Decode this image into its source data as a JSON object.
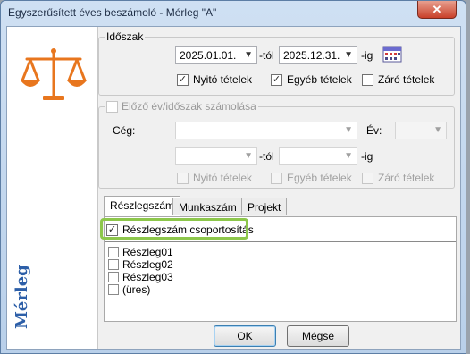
{
  "window": {
    "title": "Egyszerűsített éves beszámoló - Mérleg \"A\"",
    "close_glyph": "✕",
    "sidebar_label": "Mérleg"
  },
  "period": {
    "legend": "Időszak",
    "from_date": "2025.01.01.",
    "from_suffix": "-tól",
    "to_date": "2025.12.31.",
    "to_suffix": "-ig",
    "checkboxes": [
      {
        "label": "Nyitó tételek",
        "checked": true
      },
      {
        "label": "Egyéb tételek",
        "checked": true
      },
      {
        "label": "Záró tételek",
        "checked": false
      }
    ]
  },
  "previous": {
    "legend": "Előző év/időszak számolása",
    "company_label": "Cég:",
    "company_value": "",
    "year_label": "Év:",
    "year_value": "",
    "from_value": "",
    "from_suffix": "-tól",
    "to_value": "",
    "to_suffix": "-ig",
    "checkboxes": [
      {
        "label": "Nyitó tételek",
        "checked": false
      },
      {
        "label": "Egyéb tételek",
        "checked": false
      },
      {
        "label": "Záró tételek",
        "checked": false
      }
    ]
  },
  "tabs": [
    {
      "label": "Részlegszám",
      "active": true
    },
    {
      "label": "Munkaszám",
      "active": false
    },
    {
      "label": "Projekt",
      "active": false
    }
  ],
  "grouping": {
    "label": "Részlegszám csoportosítás",
    "checked": true
  },
  "list": [
    {
      "label": "Részleg01",
      "checked": false
    },
    {
      "label": "Részleg02",
      "checked": false
    },
    {
      "label": "Részleg03",
      "checked": false
    },
    {
      "label": "(üres)",
      "checked": false
    }
  ],
  "buttons": {
    "ok_label": "OK",
    "cancel_label": "Mégse"
  },
  "check_glyph": "✓",
  "dropdown_glyph": "▼",
  "colors": {
    "title_text": "#1e2d45",
    "highlight": "#8dc74b",
    "sidebar_label": "#2d5fa8",
    "scale_icon": "#e8761e",
    "close_button": "#c9402a"
  }
}
